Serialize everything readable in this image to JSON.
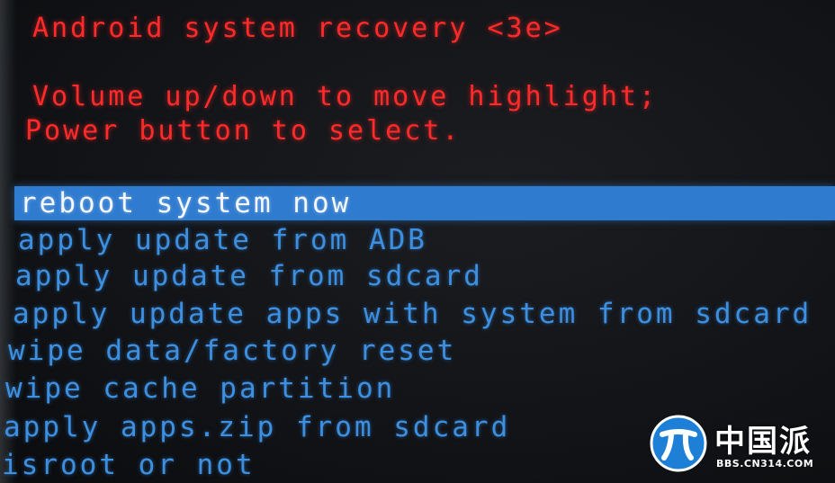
{
  "recovery": {
    "title": "Android system recovery <3e>",
    "instructions": [
      "Volume up/down to move highlight;",
      "Power button to select."
    ]
  },
  "menu": {
    "items": [
      {
        "label": "reboot system now",
        "selected": true
      },
      {
        "label": "apply update from ADB",
        "selected": false
      },
      {
        "label": "apply update from sdcard",
        "selected": false
      },
      {
        "label": "apply update apps with system from sdcard",
        "selected": false
      },
      {
        "label": "wipe data/factory reset",
        "selected": false
      },
      {
        "label": "wipe cache partition",
        "selected": false
      },
      {
        "label": "apply apps.zip from sdcard",
        "selected": false
      },
      {
        "label": "isroot or not",
        "selected": false
      }
    ]
  },
  "watermark": {
    "brand": "中国派",
    "url": "BBS.CN314.COM"
  },
  "colors": {
    "header_red": "#ff2a2a",
    "menu_blue": "#3d8fe0",
    "highlight_bg": "#2f7bd0",
    "highlight_text": "#f4f7fb",
    "screen_bg": "#121418"
  }
}
